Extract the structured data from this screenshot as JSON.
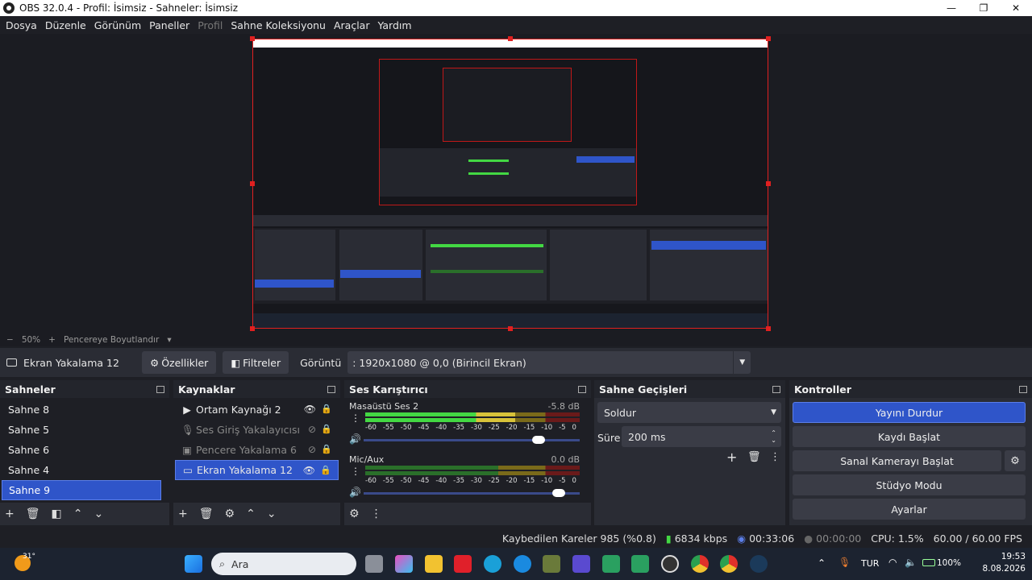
{
  "window": {
    "title": "OBS 32.0.4 - Profil: İsimsiz - Sahneler: İsimsiz",
    "minimize": "—",
    "maximize": "❐",
    "close": "✕"
  },
  "menu": {
    "items": [
      "Dosya",
      "Düzenle",
      "Görünüm",
      "Paneller",
      "Profil",
      "Sahne Koleksiyonu",
      "Araçlar",
      "Yardım"
    ],
    "disabled_index": 4
  },
  "zoom": {
    "minus": "−",
    "value": "50%",
    "plus": "+",
    "fit_label": "Pencereye Boyutlandır"
  },
  "source_bar": {
    "current_source": "Ekran Yakalama 12",
    "properties": "Özellikler",
    "filters": "Filtreler",
    "display_label": "Görüntü",
    "display_value": ": 1920x1080 @ 0,0 (Birincil Ekran)"
  },
  "scenes": {
    "title": "Sahneler",
    "items": [
      "Sahne 8",
      "Sahne 5",
      "Sahne 6",
      "Sahne 4",
      "Sahne 9"
    ],
    "selected_index": 4
  },
  "sources": {
    "title": "Kaynaklar",
    "items": [
      {
        "label": "Ortam Kaynağı 2",
        "icon": "play-icon",
        "visible": true
      },
      {
        "label": "Ses Giriş Yakalayıcısı",
        "icon": "microphone-icon",
        "visible": false
      },
      {
        "label": "Pencere Yakalama 6",
        "icon": "window-icon",
        "visible": false
      },
      {
        "label": "Ekran Yakalama 12",
        "icon": "monitor-icon",
        "visible": true
      }
    ],
    "selected_index": 3
  },
  "mixer": {
    "title": "Ses Karıştırıcı",
    "scale": [
      "-60",
      "-55",
      "-50",
      "-45",
      "-40",
      "-35",
      "-30",
      "-25",
      "-20",
      "-15",
      "-10",
      "-5",
      "0"
    ],
    "channels": [
      {
        "name": "Masaüstü Ses 2",
        "db": "-5.8 dB",
        "level": 0.7,
        "volume": 0.9
      },
      {
        "name": "Mic/Aux",
        "db": "0.0 dB",
        "level": 0.0,
        "volume": 1.0
      }
    ]
  },
  "transitions": {
    "title": "Sahne Geçişleri",
    "selected": "Soldur",
    "duration_label": "Süre",
    "duration_value": "200 ms"
  },
  "controls": {
    "title": "Kontroller",
    "buttons": [
      "Yayını Durdur",
      "Kaydı Başlat",
      "Sanal Kamerayı Başlat",
      "Stüdyo Modu",
      "Ayarlar"
    ]
  },
  "status": {
    "dropped": "Kaybedilen Kareler 985 (%0.8)",
    "bitrate": "6834 kbps",
    "stream_time": "00:33:06",
    "rec_time": "00:00:00",
    "cpu": "CPU: 1.5%",
    "fps": "60.00 / 60.00 FPS"
  },
  "taskbar": {
    "weather": "31°",
    "search": "Ara",
    "lang": "TUR",
    "battery": "100%",
    "time": "19:53",
    "date": "8.08.2026"
  },
  "colors": {
    "accent": "#2f55c9",
    "selection_border": "#e02020",
    "meter_green": "#43d843",
    "meter_yellow": "#d8c23a",
    "meter_red": "#6a1a1a"
  }
}
